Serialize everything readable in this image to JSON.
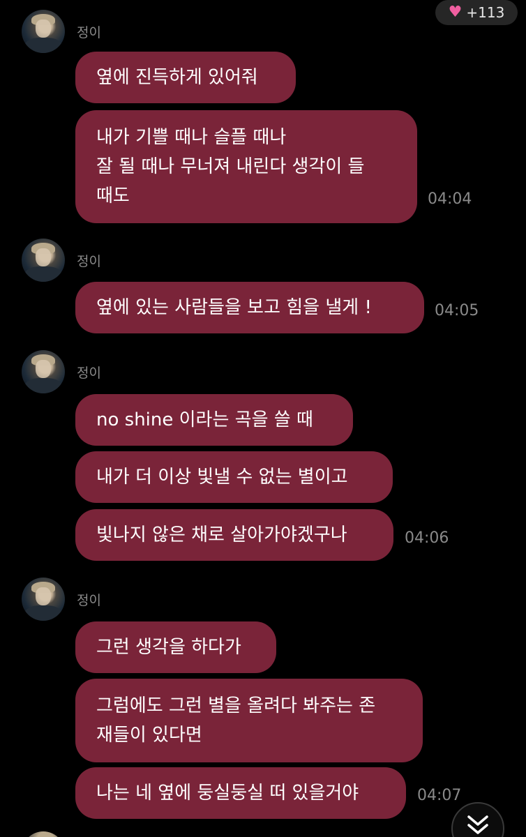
{
  "badge": {
    "heart_icon": "heart-icon",
    "count": "+113",
    "heart_color": "#f05fa0"
  },
  "colors": {
    "bubble": "#7a2439",
    "background": "#000000",
    "meta_text": "#8a8a8a"
  },
  "groups": [
    {
      "sender": "정이",
      "messages": [
        {
          "lines": [
            "옆에 진득하게 있어줘"
          ]
        },
        {
          "lines": [
            "내가 기쁠 때나 슬플 때나",
            "잘 될 때나 무너져 내린다 생각이 들",
            "때도"
          ],
          "time": "04:04"
        }
      ]
    },
    {
      "sender": "정이",
      "messages": [
        {
          "lines": [
            "옆에 있는 사람들을 보고 힘을 낼게 !"
          ],
          "time": "04:05"
        }
      ]
    },
    {
      "sender": "정이",
      "messages": [
        {
          "lines": [
            "no shine 이라는 곡을 쓸 때"
          ]
        },
        {
          "lines": [
            "내가 더 이상 빛낼 수 없는 별이고"
          ]
        },
        {
          "lines": [
            "빛나지 않은 채로 살아가야겠구나"
          ],
          "time": "04:06"
        }
      ]
    },
    {
      "sender": "정이",
      "messages": [
        {
          "lines": [
            "그런 생각을 하다가"
          ]
        },
        {
          "lines": [
            "그럼에도 그런 별을 올려다 봐주는 존",
            "재들이 있다면"
          ]
        },
        {
          "lines": [
            "나는 네 옆에 둥실둥실 떠 있을거야"
          ],
          "time": "04:07"
        }
      ]
    }
  ],
  "scroll_button": {
    "icon": "double-chevron-down-icon"
  }
}
